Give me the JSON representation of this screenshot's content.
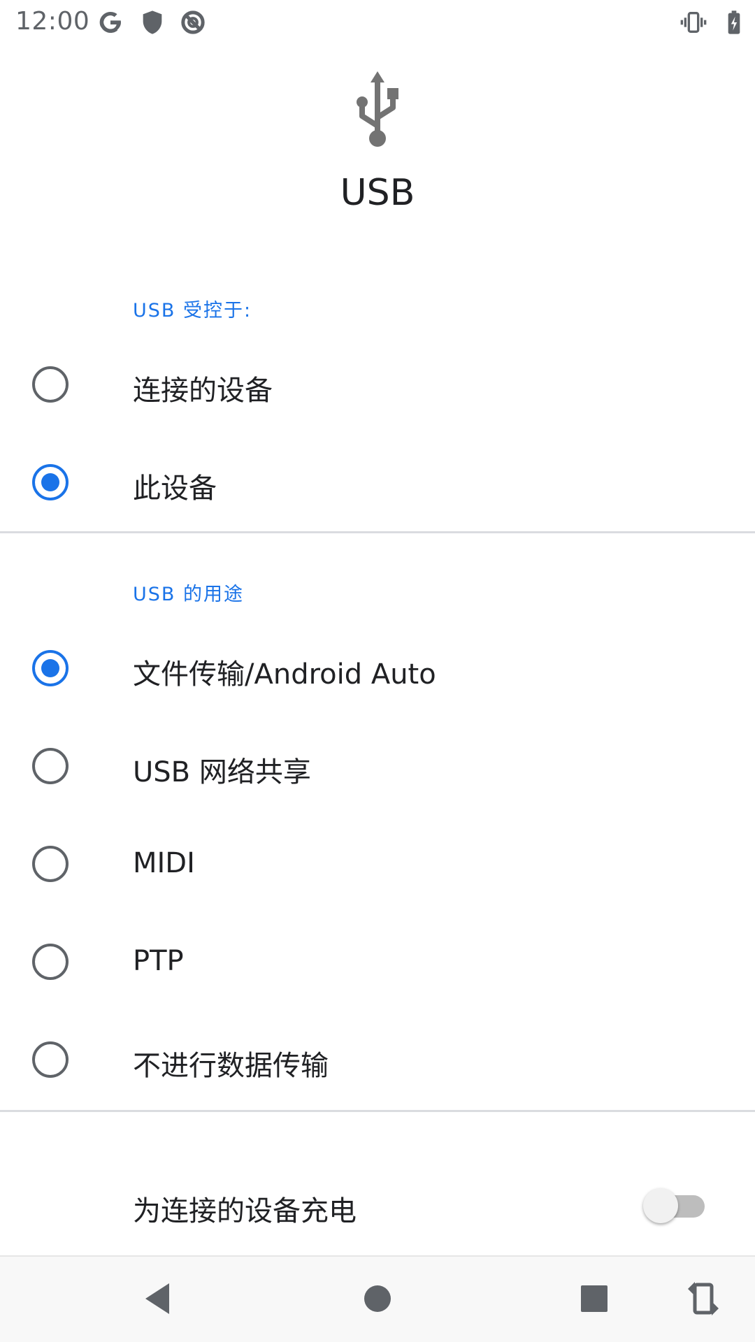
{
  "status_bar": {
    "time": "12:00",
    "left_icons": [
      "google-g-icon",
      "shield-icon",
      "data-saver-icon"
    ],
    "right_icons": [
      "vibrate-icon",
      "battery-charging-icon"
    ]
  },
  "header": {
    "icon": "usb-icon",
    "title": "USB"
  },
  "usb_controlled_by": {
    "header": "USB 受控于:",
    "options": [
      {
        "label": "连接的设备",
        "checked": false
      },
      {
        "label": "此设备",
        "checked": true
      }
    ]
  },
  "use_usb_for": {
    "header": "USB 的用途",
    "options": [
      {
        "label": "文件传输/Android Auto",
        "checked": true
      },
      {
        "label": "USB 网络共享",
        "checked": false
      },
      {
        "label": "MIDI",
        "checked": false
      },
      {
        "label": "PTP",
        "checked": false
      },
      {
        "label": "不进行数据传输",
        "checked": false
      }
    ]
  },
  "charge_switch": {
    "label": "为连接的设备充电",
    "on": false
  },
  "nav_bar": {
    "buttons": [
      "back-icon",
      "home-icon",
      "recents-icon",
      "rotate-icon"
    ]
  },
  "colors": {
    "accent": "#1a73e8",
    "text_primary": "#202124",
    "icon_gray": "#5f6368"
  }
}
